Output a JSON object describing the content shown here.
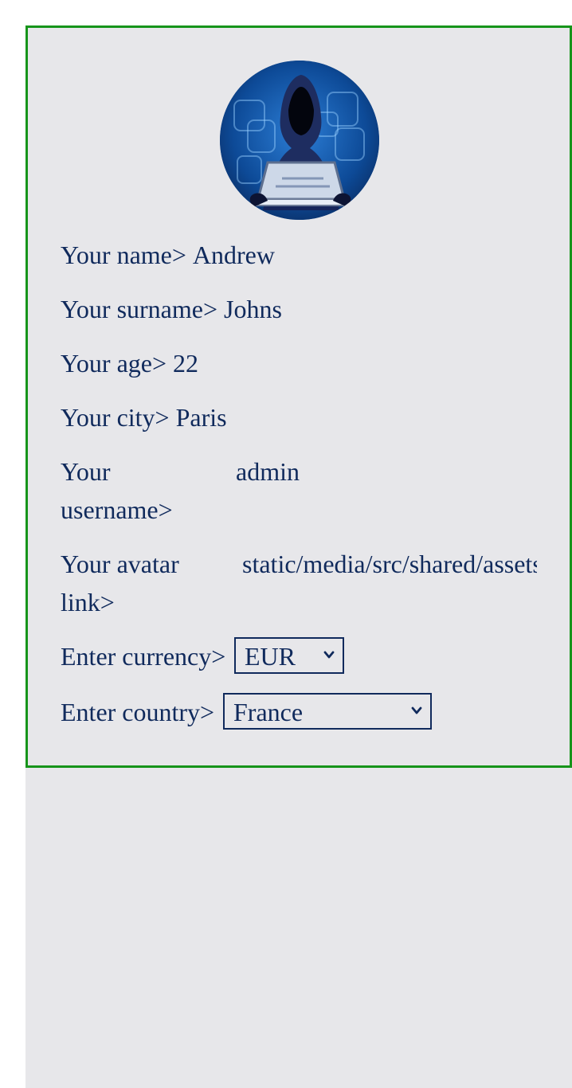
{
  "profile": {
    "name_label": "Your name>",
    "name_value": "Andrew",
    "surname_label": "Your surname>",
    "surname_value": "Johns",
    "age_label": "Your age>",
    "age_value": "22",
    "city_label": "Your city>",
    "city_value": "Paris",
    "username_label": "Your username>",
    "username_value": "admin",
    "avatar_link_label": "Your avatar link>",
    "avatar_link_value": "static/media/src/shared/assets",
    "currency_label": "Enter currency>",
    "currency_value": "EUR",
    "country_label": "Enter country>",
    "country_value": "France"
  },
  "icons": {
    "avatar": "hooded-hacker-avatar",
    "select_arrow": "chevron-down-icon"
  },
  "colors": {
    "text": "#102a5c",
    "card_border": "#16941a",
    "background": "#e7e7ea",
    "avatar_bg": "#0b3f85"
  }
}
